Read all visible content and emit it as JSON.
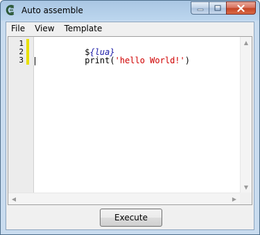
{
  "window": {
    "title": "Auto assemble",
    "icon": "cheat-engine-icon"
  },
  "caption_buttons": {
    "minimize_icon": "minimize-icon",
    "maximize_icon": "maximize-icon",
    "close_icon": "close-icon"
  },
  "menu": {
    "items": [
      {
        "label": "File"
      },
      {
        "label": "View"
      },
      {
        "label": "Template"
      }
    ]
  },
  "editor": {
    "line_numbers": [
      "1",
      "2",
      "3"
    ],
    "lines": [
      {
        "tokens": [
          {
            "text": "$",
            "kind": "plain"
          },
          {
            "text": "{lua}",
            "kind": "tag"
          }
        ]
      },
      {
        "tokens": [
          {
            "text": "print(",
            "kind": "plain"
          },
          {
            "text": "'hello World!'",
            "kind": "str"
          },
          {
            "text": ")",
            "kind": "plain"
          }
        ]
      },
      {
        "tokens": []
      }
    ],
    "colors": {
      "tag": "#1a1aa6",
      "string": "#d00000",
      "change_marker": "#e8e000"
    }
  },
  "footer": {
    "execute_label": "Execute"
  }
}
